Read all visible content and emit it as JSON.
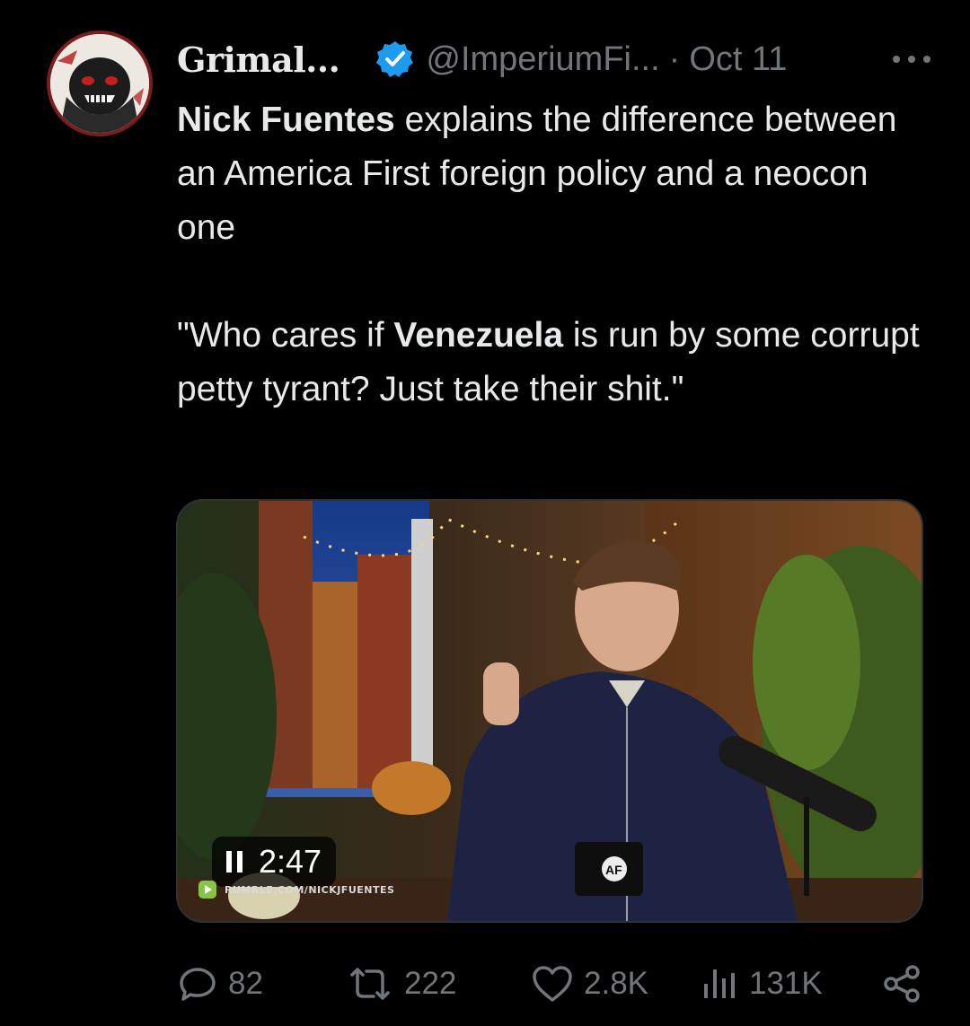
{
  "tweet": {
    "author": {
      "display_name": "Grimal...",
      "handle": "@ImperiumFi...",
      "verified": true,
      "verified_color": "#1d9bf0"
    },
    "separator": "·",
    "date": "Oct 11",
    "text": {
      "line1_bold": "Nick Fuentes",
      "line1_rest": " explains the difference between an America First foreign policy and a neocon one",
      "quote_start": "\"Who cares if ",
      "quote_bold": "Venezuela",
      "quote_rest": " is run by some corrupt petty tyrant? Just take their shit.\""
    },
    "media": {
      "type": "video",
      "duration": "2:47",
      "state_icon": "pause-icon",
      "watermark": "RUMBLE.COM/NICKJFUENTES",
      "mug_text": "AF"
    },
    "stats": {
      "replies": "82",
      "reposts": "222",
      "likes": "2.8K",
      "views": "131K"
    },
    "icons": {
      "reply": "reply-icon",
      "repost": "repost-icon",
      "like": "heart-icon",
      "views": "views-icon",
      "share": "share-icon",
      "more": "more-icon"
    }
  }
}
